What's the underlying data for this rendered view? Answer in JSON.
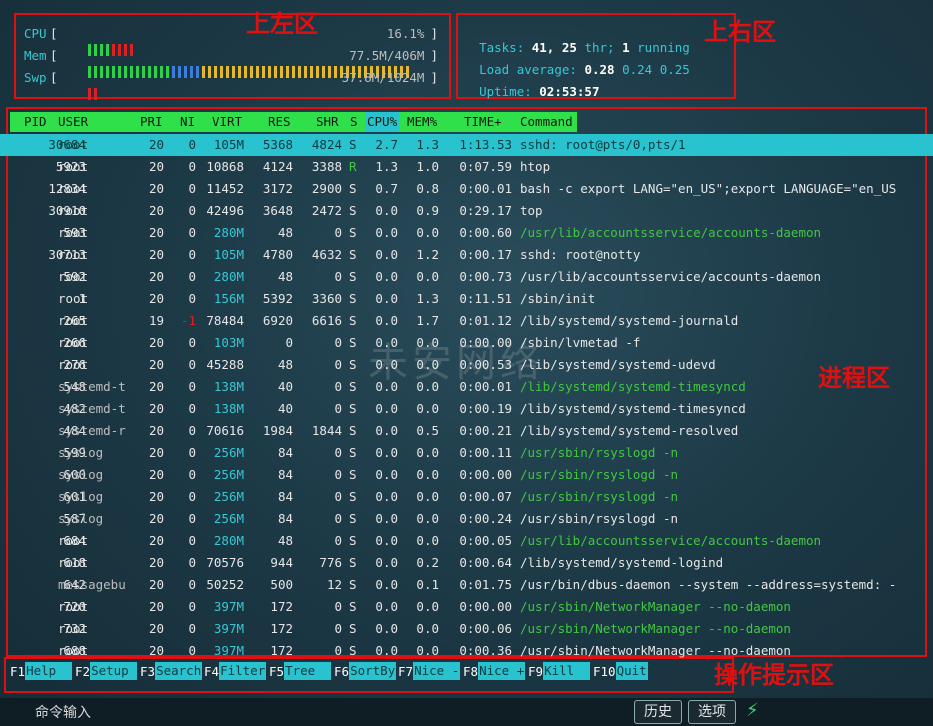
{
  "meters": {
    "cpu": {
      "label": "CPU",
      "value": "16.1%"
    },
    "mem": {
      "label": "Mem",
      "value": "77.5M/406M"
    },
    "swp": {
      "label": "Swp",
      "value": "37.8M/1024M"
    }
  },
  "summary": {
    "tasks_label": "Tasks:",
    "tasks": "41,",
    "threads": "25",
    "thr_label": "thr;",
    "running": "1",
    "running_label": "running",
    "load_label": "Load average:",
    "load1": "0.28",
    "load5": "0.24",
    "load15": "0.25",
    "uptime_label": "Uptime:",
    "uptime": "02:53:57"
  },
  "zones": {
    "top_left": "上左区",
    "top_right": "上右区",
    "process": "进程区",
    "hints": "操作提示区"
  },
  "watermark": "未安网络",
  "columns": [
    "PID",
    "USER",
    "PRI",
    "NI",
    "VIRT",
    "RES",
    "SHR",
    "S",
    "CPU%",
    "MEM%",
    "TIME+",
    "Command"
  ],
  "processes": [
    {
      "pid": "30684",
      "user": "root",
      "pri": "20",
      "ni": "0",
      "virt": "105M",
      "res": "5368",
      "shr": "4824",
      "s": "S",
      "cpu": "2.7",
      "mem": "1.3",
      "time": "1:13.53",
      "cmd": "sshd: root@pts/0,pts/1",
      "sel": true
    },
    {
      "pid": "5923",
      "user": "root",
      "pri": "20",
      "ni": "0",
      "virt": "10868",
      "res": "4124",
      "shr": "3388",
      "s": "R",
      "cpu": "1.3",
      "mem": "1.0",
      "time": "0:07.59",
      "cmd": "htop"
    },
    {
      "pid": "12834",
      "user": "root",
      "pri": "20",
      "ni": "0",
      "virt": "11452",
      "res": "3172",
      "shr": "2900",
      "s": "S",
      "cpu": "0.7",
      "mem": "0.8",
      "time": "0:00.01",
      "cmd": "bash -c export LANG=\"en_US\";export LANGUAGE=\"en_US"
    },
    {
      "pid": "30910",
      "user": "root",
      "pri": "20",
      "ni": "0",
      "virt": "42496",
      "res": "3648",
      "shr": "2472",
      "s": "S",
      "cpu": "0.0",
      "mem": "0.9",
      "time": "0:29.17",
      "cmd": "top"
    },
    {
      "pid": "593",
      "user": "root",
      "pri": "20",
      "ni": "0",
      "virt": "280M",
      "res": "48",
      "shr": "0",
      "s": "S",
      "cpu": "0.0",
      "mem": "0.0",
      "time": "0:00.60",
      "cmd": "/usr/lib/accountsservice/accounts-daemon",
      "green": true
    },
    {
      "pid": "30713",
      "user": "root",
      "pri": "20",
      "ni": "0",
      "virt": "105M",
      "res": "4780",
      "shr": "4632",
      "s": "S",
      "cpu": "0.0",
      "mem": "1.2",
      "time": "0:00.17",
      "cmd": "sshd: root@notty"
    },
    {
      "pid": "592",
      "user": "root",
      "pri": "20",
      "ni": "0",
      "virt": "280M",
      "res": "48",
      "shr": "0",
      "s": "S",
      "cpu": "0.0",
      "mem": "0.0",
      "time": "0:00.73",
      "cmd": "/usr/lib/accountsservice/accounts-daemon"
    },
    {
      "pid": "1",
      "user": "root",
      "pri": "20",
      "ni": "0",
      "virt": "156M",
      "res": "5392",
      "shr": "3360",
      "s": "S",
      "cpu": "0.0",
      "mem": "1.3",
      "time": "0:11.51",
      "cmd": "/sbin/init"
    },
    {
      "pid": "265",
      "user": "root",
      "pri": "19",
      "ni": "-1",
      "virt": "78484",
      "res": "6920",
      "shr": "6616",
      "s": "S",
      "cpu": "0.0",
      "mem": "1.7",
      "time": "0:01.12",
      "cmd": "/lib/systemd/systemd-journald"
    },
    {
      "pid": "266",
      "user": "root",
      "pri": "20",
      "ni": "0",
      "virt": "103M",
      "res": "0",
      "shr": "0",
      "s": "S",
      "cpu": "0.0",
      "mem": "0.0",
      "time": "0:00.00",
      "cmd": "/sbin/lvmetad -f"
    },
    {
      "pid": "276",
      "user": "root",
      "pri": "20",
      "ni": "0",
      "virt": "45288",
      "res": "48",
      "shr": "0",
      "s": "S",
      "cpu": "0.0",
      "mem": "0.0",
      "time": "0:00.53",
      "cmd": "/lib/systemd/systemd-udevd"
    },
    {
      "pid": "548",
      "user": "systemd-t",
      "pri": "20",
      "ni": "0",
      "virt": "138M",
      "res": "40",
      "shr": "0",
      "s": "S",
      "cpu": "0.0",
      "mem": "0.0",
      "time": "0:00.01",
      "cmd": "/lib/systemd/systemd-timesyncd",
      "green": true
    },
    {
      "pid": "482",
      "user": "systemd-t",
      "pri": "20",
      "ni": "0",
      "virt": "138M",
      "res": "40",
      "shr": "0",
      "s": "S",
      "cpu": "0.0",
      "mem": "0.0",
      "time": "0:00.19",
      "cmd": "/lib/systemd/systemd-timesyncd"
    },
    {
      "pid": "484",
      "user": "systemd-r",
      "pri": "20",
      "ni": "0",
      "virt": "70616",
      "res": "1984",
      "shr": "1844",
      "s": "S",
      "cpu": "0.0",
      "mem": "0.5",
      "time": "0:00.21",
      "cmd": "/lib/systemd/systemd-resolved"
    },
    {
      "pid": "599",
      "user": "syslog",
      "pri": "20",
      "ni": "0",
      "virt": "256M",
      "res": "84",
      "shr": "0",
      "s": "S",
      "cpu": "0.0",
      "mem": "0.0",
      "time": "0:00.11",
      "cmd": "/usr/sbin/rsyslogd -n",
      "green": true
    },
    {
      "pid": "600",
      "user": "syslog",
      "pri": "20",
      "ni": "0",
      "virt": "256M",
      "res": "84",
      "shr": "0",
      "s": "S",
      "cpu": "0.0",
      "mem": "0.0",
      "time": "0:00.00",
      "cmd": "/usr/sbin/rsyslogd -n",
      "green": true
    },
    {
      "pid": "601",
      "user": "syslog",
      "pri": "20",
      "ni": "0",
      "virt": "256M",
      "res": "84",
      "shr": "0",
      "s": "S",
      "cpu": "0.0",
      "mem": "0.0",
      "time": "0:00.07",
      "cmd": "/usr/sbin/rsyslogd -n",
      "green": true
    },
    {
      "pid": "587",
      "user": "syslog",
      "pri": "20",
      "ni": "0",
      "virt": "256M",
      "res": "84",
      "shr": "0",
      "s": "S",
      "cpu": "0.0",
      "mem": "0.0",
      "time": "0:00.24",
      "cmd": "/usr/sbin/rsyslogd -n"
    },
    {
      "pid": "684",
      "user": "root",
      "pri": "20",
      "ni": "0",
      "virt": "280M",
      "res": "48",
      "shr": "0",
      "s": "S",
      "cpu": "0.0",
      "mem": "0.0",
      "time": "0:00.05",
      "cmd": "/usr/lib/accountsservice/accounts-daemon",
      "green": true
    },
    {
      "pid": "618",
      "user": "root",
      "pri": "20",
      "ni": "0",
      "virt": "70576",
      "res": "944",
      "shr": "776",
      "s": "S",
      "cpu": "0.0",
      "mem": "0.2",
      "time": "0:00.64",
      "cmd": "/lib/systemd/systemd-logind"
    },
    {
      "pid": "642",
      "user": "messagebu",
      "pri": "20",
      "ni": "0",
      "virt": "50252",
      "res": "500",
      "shr": "12",
      "s": "S",
      "cpu": "0.0",
      "mem": "0.1",
      "time": "0:01.75",
      "cmd": "/usr/bin/dbus-daemon --system --address=systemd: -"
    },
    {
      "pid": "720",
      "user": "root",
      "pri": "20",
      "ni": "0",
      "virt": "397M",
      "res": "172",
      "shr": "0",
      "s": "S",
      "cpu": "0.0",
      "mem": "0.0",
      "time": "0:00.00",
      "cmd": "/usr/sbin/NetworkManager --no-daemon",
      "green": true
    },
    {
      "pid": "732",
      "user": "root",
      "pri": "20",
      "ni": "0",
      "virt": "397M",
      "res": "172",
      "shr": "0",
      "s": "S",
      "cpu": "0.0",
      "mem": "0.0",
      "time": "0:00.06",
      "cmd": "/usr/sbin/NetworkManager --no-daemon",
      "green": true
    },
    {
      "pid": "688",
      "user": "root",
      "pri": "20",
      "ni": "0",
      "virt": "397M",
      "res": "172",
      "shr": "0",
      "s": "S",
      "cpu": "0.0",
      "mem": "0.0",
      "time": "0:00.36",
      "cmd": "/usr/sbin/NetworkManager --no-daemon"
    }
  ],
  "fkeys": [
    {
      "key": "F1",
      "label": "Help  "
    },
    {
      "key": "F2",
      "label": "Setup "
    },
    {
      "key": "F3",
      "label": "Search"
    },
    {
      "key": "F4",
      "label": "Filter"
    },
    {
      "key": "F5",
      "label": "Tree  "
    },
    {
      "key": "F6",
      "label": "SortBy"
    },
    {
      "key": "F7",
      "label": "Nice -"
    },
    {
      "key": "F8",
      "label": "Nice +"
    },
    {
      "key": "F9",
      "label": "Kill  "
    },
    {
      "key": "F10",
      "label": "Quit"
    }
  ],
  "bottom": {
    "cmd_label": "命令输入",
    "history": "历史",
    "options": "选项"
  },
  "colors": {
    "cyan": "#29c3cf",
    "green": "#2fe04b",
    "red": "#e01010"
  }
}
